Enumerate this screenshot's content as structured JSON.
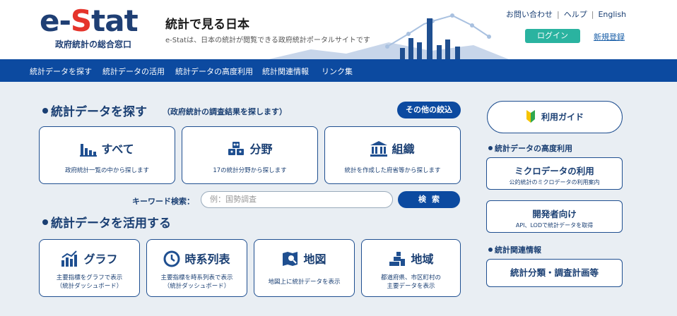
{
  "header": {
    "logo_prefix": "e-",
    "logo_s": "S",
    "logo_suffix": "tat",
    "logo_sub": "政府統計の総合窓口",
    "site_title": "統計で見る日本",
    "site_desc": "e-Statは、日本の統計が閲覧できる政府統計ポータルサイトです",
    "links": {
      "contact": "お問い合わせ",
      "help": "ヘルプ",
      "english": "English",
      "separator": "|"
    },
    "login": "ログイン",
    "register": "新規登録"
  },
  "nav": {
    "items": [
      "統計データを探す",
      "統計データの活用",
      "統計データの高度利用",
      "統計関連情報",
      "リンク集"
    ]
  },
  "find": {
    "title": "統計データを探す",
    "subtitle": "（政府統計の調査結果を探します）",
    "filter_button": "その他の絞込",
    "cards": [
      {
        "title": "すべて",
        "desc": "政府統計一覧の中から探します",
        "icon": "bar-chart-icon"
      },
      {
        "title": "分野",
        "desc": "17の統計分野から探します",
        "icon": "cubes-icon"
      },
      {
        "title": "組織",
        "desc": "統計を作成した府省等から探します",
        "icon": "government-building-icon"
      }
    ],
    "keyword_label": "キーワード検索：",
    "keyword_placeholder": "例：国勢調査",
    "search_button": "検索"
  },
  "use": {
    "title": "統計データを活用する",
    "cards": [
      {
        "title": "グラフ",
        "desc1": "主要指標をグラフで表示",
        "desc2": "（統計ダッシュボード）",
        "icon": "graph-icon"
      },
      {
        "title": "時系列表",
        "desc1": "主要指標を時系列表で表示",
        "desc2": "（統計ダッシュボード）",
        "icon": "clock-icon"
      },
      {
        "title": "地図",
        "desc1": "地図上に統計データを表示",
        "desc2": "",
        "icon": "map-search-icon"
      },
      {
        "title": "地域",
        "desc1": "都道府県、市区町村の",
        "desc2": "主要データを表示",
        "icon": "region-icon"
      }
    ]
  },
  "side": {
    "guide": "利用ガイド",
    "advanced_head": "統計データの高度利用",
    "micro_title": "ミクロデータの利用",
    "micro_desc": "公的統計のミクロデータの利用案内",
    "dev_title": "開発者向け",
    "dev_desc": "API、LODで統計データを取得",
    "related_head": "統計関連情報",
    "classification_title": "統計分類・調査計画等"
  },
  "colors": {
    "brand_navy": "#1a3f73",
    "nav_blue": "#0c4aa0",
    "login_teal": "#2ab3a0",
    "logo_red": "#e5342b"
  }
}
